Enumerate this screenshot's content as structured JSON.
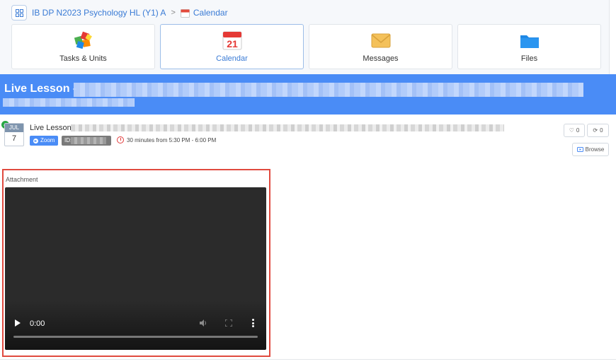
{
  "breadcrumb": {
    "course": "IB DP N2023 Psychology HL (Y1) A",
    "separator": ">",
    "current": "Calendar",
    "calendar_icon_day": "21"
  },
  "tiles": [
    {
      "label": "Tasks & Units",
      "icon": "puzzle-icon"
    },
    {
      "label": "Calendar",
      "icon": "calendar-icon",
      "active": true
    },
    {
      "label": "Messages",
      "icon": "envelope-icon"
    },
    {
      "label": "Files",
      "icon": "folder-icon"
    }
  ],
  "banner": {
    "title": "Live Lesson -"
  },
  "event": {
    "date_month": "JUL",
    "date_day": "7",
    "title": "Live Lesson -",
    "zoom_label": "Zoom",
    "id_label": "ID:",
    "time": "30 minutes from 5:30 PM - 6:00 PM",
    "likes": "0",
    "shares": "0",
    "browse_label": "Browse"
  },
  "attachment": {
    "label": "Attachment",
    "video_time": "0:00"
  },
  "colors": {
    "accent": "#4a8cf6",
    "highlight_border": "#e04a3f",
    "check": "#28a745"
  }
}
